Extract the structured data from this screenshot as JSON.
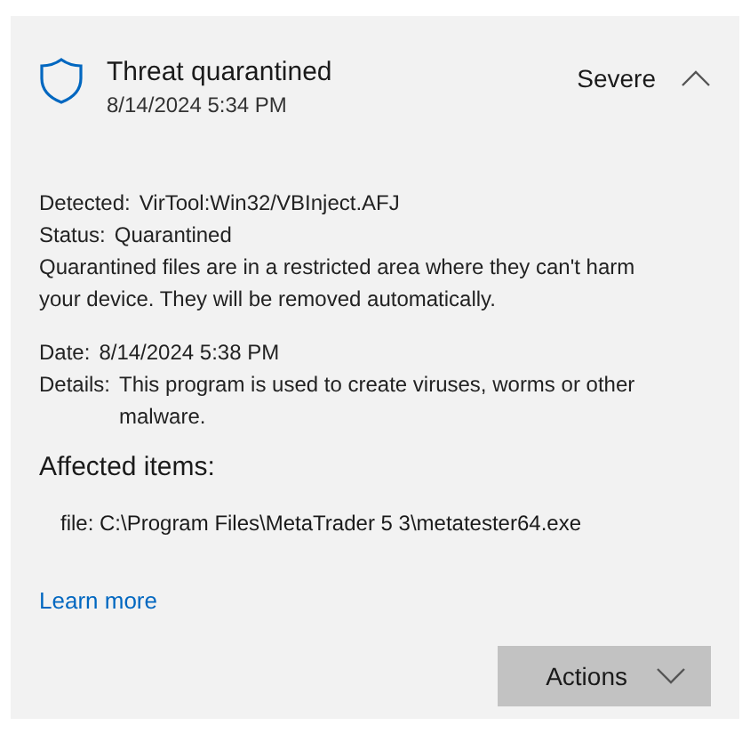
{
  "header": {
    "title": "Threat quarantined",
    "time": "8/14/2024 5:34 PM",
    "severity": "Severe",
    "expanded": true
  },
  "details": [
    {
      "kind": "field",
      "label": "Detected:",
      "value": "VirTool:Win32/VBInject.AFJ"
    },
    {
      "kind": "field",
      "label": "Status:",
      "value": "Quarantined"
    },
    {
      "kind": "note",
      "text": "Quarantined files are in a restricted area where they can't harm your device. They will be removed automatically."
    },
    {
      "kind": "gap"
    },
    {
      "kind": "field",
      "label": "Date:",
      "value": "8/14/2024 5:38 PM"
    },
    {
      "kind": "field",
      "label": "Details:",
      "value": "This program is used to create viruses, worms or other malware."
    }
  ],
  "affected": {
    "heading": "Affected items:",
    "items": [
      "file: C:\\Program Files\\MetaTrader 5 3\\metatester64.exe"
    ]
  },
  "link": "Learn more",
  "actions_button": "Actions"
}
